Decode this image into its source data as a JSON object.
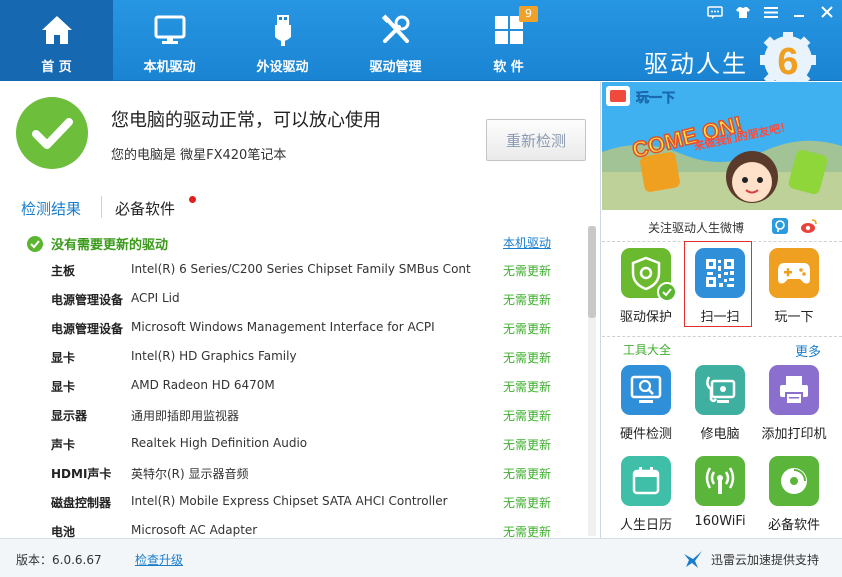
{
  "nav": {
    "items": [
      {
        "label": "首 页",
        "icon": "home-icon"
      },
      {
        "label": "本机驱动",
        "icon": "monitor-icon"
      },
      {
        "label": "外设驱动",
        "icon": "usb-icon"
      },
      {
        "label": "驱动管理",
        "icon": "tools-icon"
      },
      {
        "label": "软 件",
        "icon": "apps-grid-icon"
      }
    ],
    "software_badge": "9"
  },
  "brand": {
    "name": "驱动人生",
    "logo_digit": "6"
  },
  "status": {
    "title": "您电脑的驱动正常，可以放心使用",
    "subtitle": "您的电脑是 微星FX420笔记本",
    "recheck_label": "重新检测"
  },
  "tabs": {
    "results": "检测结果",
    "essential": "必备软件"
  },
  "results": {
    "summary": "没有需要更新的驱动",
    "summary_link": "本机驱动",
    "rows": [
      {
        "type": "主板",
        "device": "Intel(R) 6 Series/C200 Series Chipset Family SMBus Cont...",
        "status": "无需更新"
      },
      {
        "type": "电源管理设备",
        "device": "ACPI Lid",
        "status": "无需更新"
      },
      {
        "type": "电源管理设备",
        "device": "Microsoft Windows Management Interface for ACPI",
        "status": "无需更新"
      },
      {
        "type": "显卡",
        "device": "Intel(R) HD Graphics Family",
        "status": "无需更新"
      },
      {
        "type": "显卡",
        "device": "AMD Radeon HD 6470M",
        "status": "无需更新"
      },
      {
        "type": "显示器",
        "device": "通用即插即用监视器",
        "status": "无需更新"
      },
      {
        "type": "声卡",
        "device": "Realtek High Definition Audio",
        "status": "无需更新"
      },
      {
        "type": "HDMI声卡",
        "device": "英特尔(R) 显示器音频",
        "status": "无需更新"
      },
      {
        "type": "磁盘控制器",
        "device": "Intel(R) Mobile Express Chipset SATA AHCI Controller",
        "status": "无需更新"
      },
      {
        "type": "电池",
        "device": "Microsoft AC Adapter",
        "status": "无需更新"
      }
    ]
  },
  "banner": {
    "tag": "玩一下",
    "headline": "COME ON!",
    "caption": "来做我们的朋友吧！"
  },
  "follow": {
    "text": "关注驱动人生微博"
  },
  "quick_apps": [
    {
      "name": "驱动保护",
      "icon": "shield-gear-icon",
      "color": "#6ab92e"
    },
    {
      "name": "扫一扫",
      "icon": "qr-code-icon",
      "color": "#2f8fd8"
    },
    {
      "name": "玩一下",
      "icon": "gamepad-icon",
      "color": "#f0a020"
    }
  ],
  "tools": {
    "title": "工具大全",
    "more": "更多",
    "items": [
      {
        "name": "硬件检测",
        "icon": "hardware-detect-icon",
        "color": "#2f8fd8"
      },
      {
        "name": "修电脑",
        "icon": "repair-pc-icon",
        "color": "#3fb0a0"
      },
      {
        "name": "添加打印机",
        "icon": "printer-icon",
        "color": "#8a6fcf"
      },
      {
        "name": "人生日历",
        "icon": "calendar-icon",
        "color": "#3fbfa8"
      },
      {
        "name": "160WiFi",
        "icon": "wifi-icon",
        "color": "#5bb53a"
      },
      {
        "name": "必备软件",
        "icon": "disc-icon",
        "color": "#5bb53a"
      }
    ]
  },
  "footer": {
    "version": "版本：6.0.6.67",
    "update_link": "检查升级",
    "support": "迅雷云加速提供支持"
  }
}
